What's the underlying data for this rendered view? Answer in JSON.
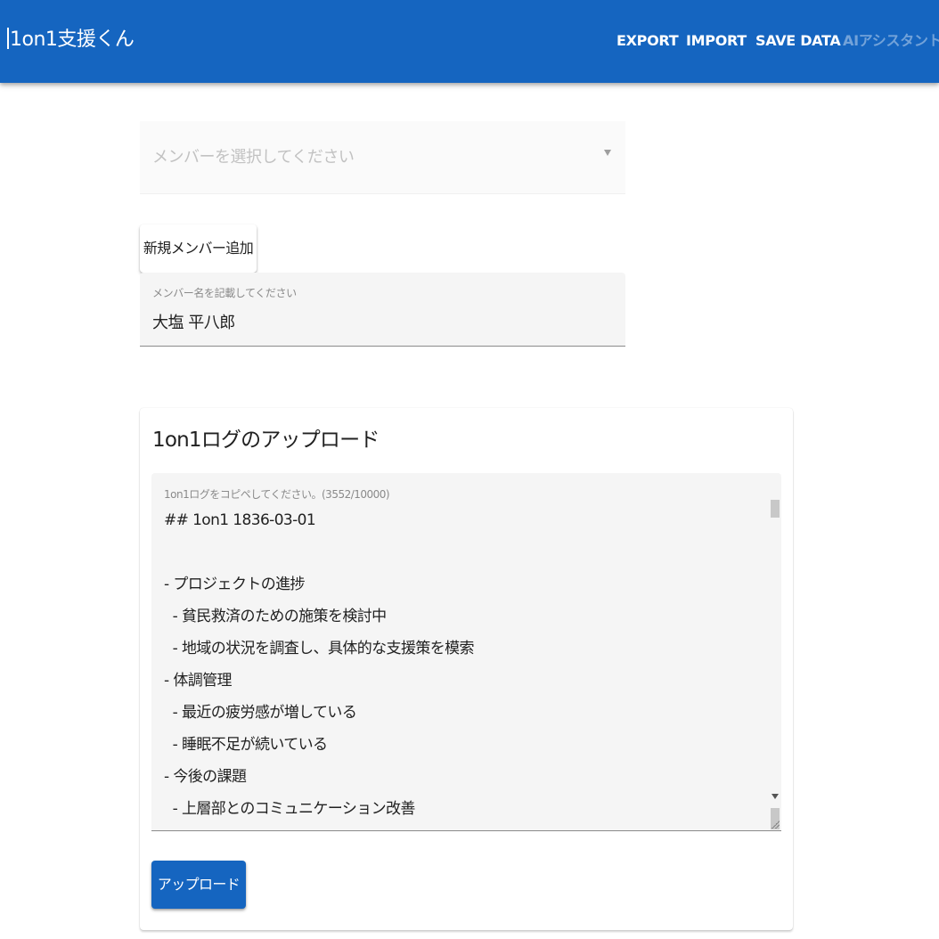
{
  "app": {
    "title": "1on1支援くん",
    "nav": {
      "export": "EXPORT",
      "import": "IMPORT",
      "save": "SAVE DATA",
      "ai": "AIアシスタント"
    },
    "colors": {
      "primary": "#1565c0",
      "nav_disabled": "rgba(255,255,255,0.4)"
    }
  },
  "member_select": {
    "placeholder": "メンバーを選択してください"
  },
  "new_member": {
    "button_label": "新規メンバー追加",
    "field_label": "メンバー名を記載してください",
    "field_value": "大塩 平八郎"
  },
  "upload_card": {
    "title": "1on1ログのアップロード",
    "textarea_label": "1on1ログをコピペしてください。(3552/10000)",
    "log_lines": [
      "## 1on1 1836-03-01",
      "",
      "- プロジェクトの進捗",
      "  - 貧民救済のための施策を検討中",
      "  - 地域の状況を調査し、具体的な支援策を模索",
      "- 体調管理",
      "  - 最近の疲労感が増している",
      "  - 睡眠不足が続いている",
      "- 今後の課題",
      "  - 上層部とのコミュニケーション改善"
    ],
    "upload_button": "アップロード"
  }
}
